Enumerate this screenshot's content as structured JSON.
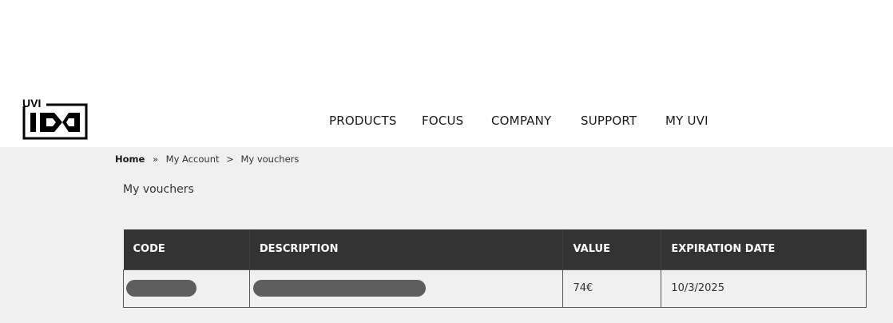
{
  "nav": {
    "items": [
      {
        "label": "PRODUCTS"
      },
      {
        "label": "FOCUS"
      },
      {
        "label": "COMPANY"
      },
      {
        "label": "SUPPORT"
      },
      {
        "label": "MY UVI"
      }
    ]
  },
  "logo": {
    "text": "UVI"
  },
  "breadcrumb": {
    "home": "Home",
    "sep1": "»",
    "account": "My Account",
    "sep2": ">",
    "current": "My vouchers"
  },
  "page": {
    "title": "My vouchers"
  },
  "table": {
    "headers": {
      "code": "CODE",
      "description": "DESCRIPTION",
      "value": "VALUE",
      "expiration": "EXPIRATION DATE"
    },
    "rows": [
      {
        "code": "",
        "description": "",
        "value": "74€",
        "expiration": "10/3/2025"
      }
    ]
  },
  "colors": {
    "header_bg": "#333333",
    "content_bg": "#f0f0f0",
    "redaction": "#5e5e5e"
  }
}
